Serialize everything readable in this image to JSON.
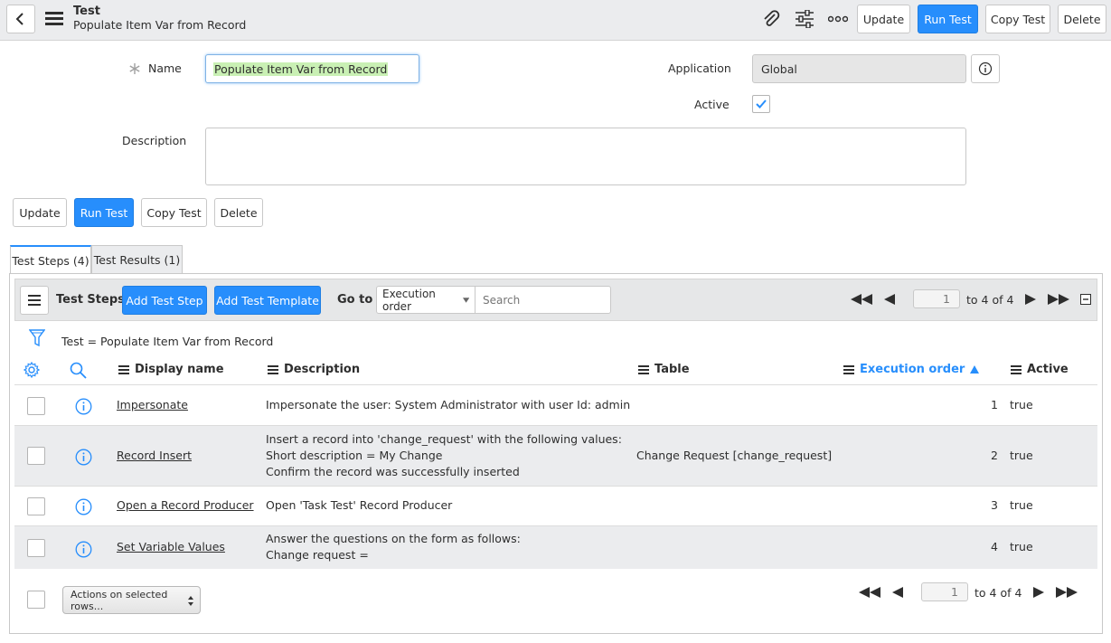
{
  "header": {
    "title": "Test",
    "subtitle": "Populate Item Var from Record",
    "buttons": {
      "update": "Update",
      "run_test": "Run Test",
      "copy_test": "Copy Test",
      "delete": "Delete"
    }
  },
  "form": {
    "name_label": "Name",
    "name_value": "Populate Item Var from Record",
    "application_label": "Application",
    "application_value": "Global",
    "active_label": "Active",
    "active_checked": true,
    "description_label": "Description",
    "description_value": ""
  },
  "form_buttons": {
    "update": "Update",
    "run_test": "Run Test",
    "copy_test": "Copy Test",
    "delete": "Delete"
  },
  "tabs": [
    {
      "label": "Test Steps (4)",
      "active": true
    },
    {
      "label": "Test Results (1)",
      "active": false
    }
  ],
  "list_toolbar": {
    "title": "Test Steps",
    "add_step": "Add Test Step",
    "add_template": "Add Test Template",
    "goto_label": "Go to",
    "goto_field": "Execution order",
    "search_placeholder": "Search",
    "page": "1",
    "range": "to 4 of 4"
  },
  "filter": {
    "text": "Test = Populate Item Var from Record"
  },
  "columns": {
    "display_name": "Display name",
    "description": "Description",
    "table": "Table",
    "execution_order": "Execution order",
    "active": "Active"
  },
  "rows": [
    {
      "name": "Impersonate",
      "desc": [
        "Impersonate the user: System Administrator with user Id: admin"
      ],
      "table": "",
      "order": "1",
      "active": "true"
    },
    {
      "name": "Record Insert",
      "desc": [
        "Insert a record into 'change_request' with the following values:",
        "Short description = My Change",
        "Confirm the record was successfully inserted"
      ],
      "table": "Change Request [change_request]",
      "order": "2",
      "active": "true"
    },
    {
      "name": "Open a Record Producer",
      "desc": [
        "Open 'Task Test' Record Producer"
      ],
      "table": "",
      "order": "3",
      "active": "true"
    },
    {
      "name": "Set Variable Values",
      "desc": [
        "Answer the questions on the form as follows:",
        "Change request ="
      ],
      "table": "",
      "order": "4",
      "active": "true"
    }
  ],
  "footer": {
    "actions_label": "Actions on selected rows...",
    "page": "1",
    "range": "to 4 of 4"
  },
  "colors": {
    "primary": "#278efc",
    "header_bg": "#ebecee",
    "name_highlight": "#c9f0b4"
  }
}
